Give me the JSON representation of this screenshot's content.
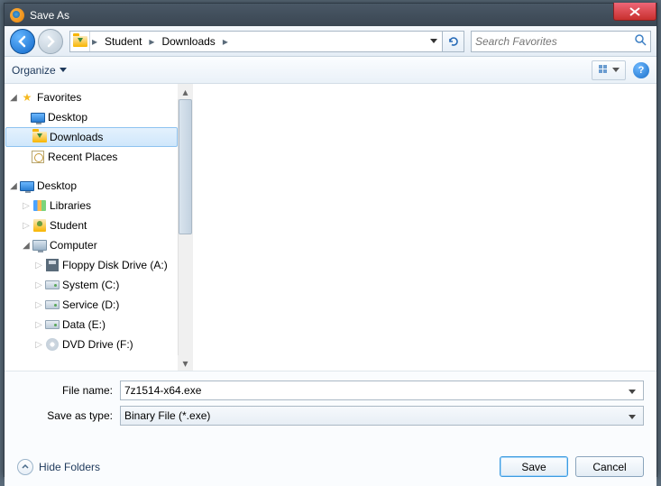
{
  "window": {
    "title": "Save As"
  },
  "nav": {
    "breadcrumb": [
      "Student",
      "Downloads"
    ],
    "search_placeholder": "Search Favorites"
  },
  "toolbar": {
    "organize": "Organize"
  },
  "tree": {
    "favorites": {
      "label": "Favorites",
      "items": [
        {
          "label": "Desktop",
          "icon": "desktop"
        },
        {
          "label": "Downloads",
          "icon": "folder-dl",
          "selected": true
        },
        {
          "label": "Recent Places",
          "icon": "recent"
        }
      ]
    },
    "desktop": {
      "label": "Desktop",
      "items": [
        {
          "label": "Libraries",
          "icon": "lib"
        },
        {
          "label": "Student",
          "icon": "user"
        }
      ]
    },
    "computer": {
      "label": "Computer",
      "items": [
        {
          "label": "Floppy Disk Drive (A:)",
          "icon": "floppy"
        },
        {
          "label": "System (C:)",
          "icon": "drive"
        },
        {
          "label": "Service (D:)",
          "icon": "drive"
        },
        {
          "label": "Data (E:)",
          "icon": "drive"
        },
        {
          "label": "DVD Drive (F:)",
          "icon": "dvd"
        }
      ]
    }
  },
  "form": {
    "filename_label": "File name:",
    "filename_value": "7z1514-x64.exe",
    "type_label": "Save as type:",
    "type_value": "Binary File (*.exe)"
  },
  "footer": {
    "hide": "Hide Folders",
    "save": "Save",
    "cancel": "Cancel"
  }
}
